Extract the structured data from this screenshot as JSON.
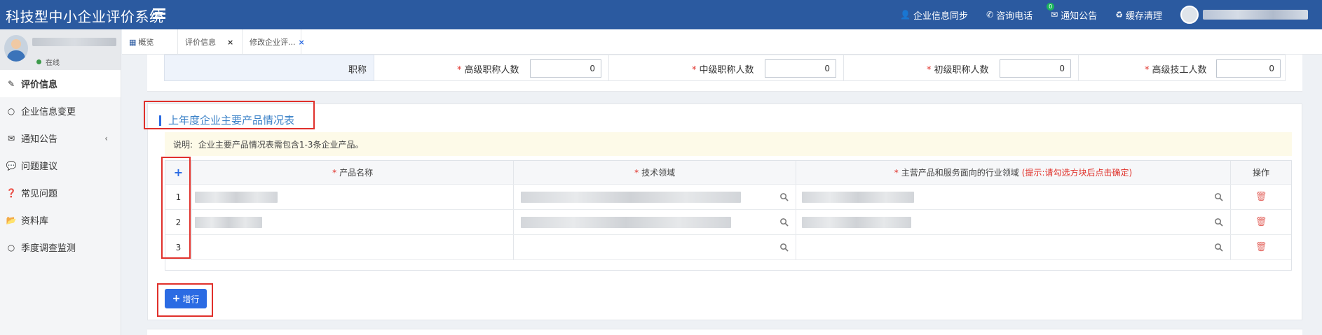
{
  "header": {
    "title": "科技型中小企业评价系统",
    "nav": [
      {
        "label": "企业信息同步",
        "icon": "user-icon"
      },
      {
        "label": "咨询电话",
        "icon": "phone-icon"
      },
      {
        "label": "通知公告",
        "icon": "mail-icon",
        "badge": "0"
      },
      {
        "label": "缓存清理",
        "icon": "recycle-icon"
      }
    ]
  },
  "sidebar": {
    "status": "在线",
    "items": [
      {
        "label": "评价信息",
        "icon": "edit-icon"
      },
      {
        "label": "企业信息变更",
        "icon": "circle-icon"
      },
      {
        "label": "通知公告",
        "icon": "mail-icon"
      },
      {
        "label": "问题建议",
        "icon": "comment-icon"
      },
      {
        "label": "常见问题",
        "icon": "question-icon"
      },
      {
        "label": "资料库",
        "icon": "folder-icon"
      },
      {
        "label": "季度调查监测",
        "icon": "circle-icon"
      }
    ]
  },
  "tabs": [
    {
      "label": "概览"
    },
    {
      "label": "评价信息"
    },
    {
      "label": "修改企业评..."
    }
  ],
  "titles_row": {
    "label": "职称",
    "fields": [
      {
        "label": "高级职称人数",
        "value": "0"
      },
      {
        "label": "中级职称人数",
        "value": "0"
      },
      {
        "label": "初级职称人数",
        "value": "0"
      },
      {
        "label": "高级技工人数",
        "value": "0"
      }
    ]
  },
  "products": {
    "section_title": "上年度企业主要产品情况表",
    "notice_label": "说明:",
    "notice_text": "企业主要产品情况表需包含1-3条企业产品。",
    "columns": {
      "add": "+",
      "name": "产品名称",
      "tech": "技术领域",
      "industry": "主营产品和服务面向的行业领域",
      "industry_tip": "(提示:请勾选方块后点击确定)",
      "action": "操作"
    },
    "rows": [
      {
        "index": "1"
      },
      {
        "index": "2"
      },
      {
        "index": "3"
      }
    ],
    "add_row_label": "增行"
  }
}
